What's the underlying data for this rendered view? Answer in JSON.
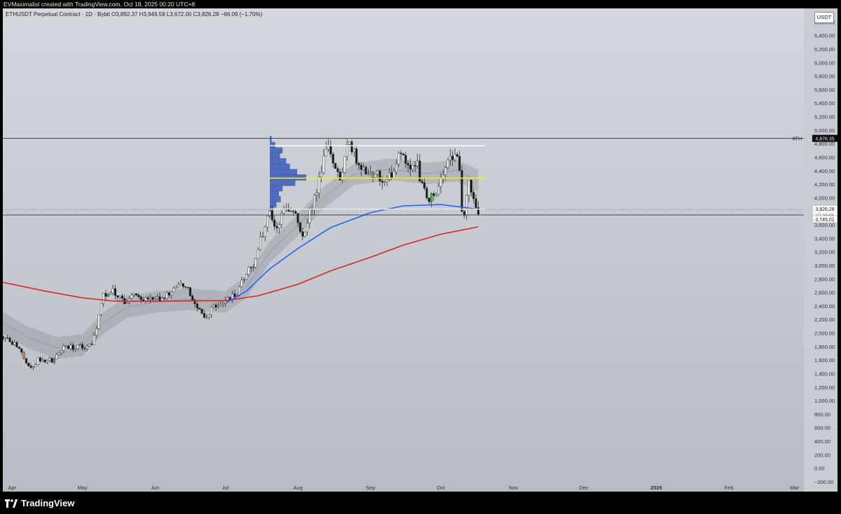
{
  "header": {
    "attribution": "EVMaximalist created with TradingView.com, Oct 18, 2025 00:20 UTC+8"
  },
  "legend": {
    "symbol": "ETHUSDT Perpetual Contract · 1D · Bybit",
    "ohlc": "O3,892.37  H3,949.59  L3,672.00  C3,826.28  −66.09 (−1.70%)"
  },
  "price_scale": {
    "unit": "USDT"
  },
  "footer": {
    "brand": "TradingView"
  },
  "colors": {
    "ma_fast": "#2962ff",
    "ma_slow": "#e02424",
    "poc_line": "#f0f020",
    "range_lines": "#ffffff",
    "volume_profile": "#3b5cb8",
    "ribbon": "#8a8d93",
    "candle_up": "#f7f7f7",
    "candle_down": "#1b1b1b",
    "candle_green": "#2ecc40",
    "candle_orange": "#c88040",
    "price_label_bg": "#ffffff",
    "ath_label_bg": "#000000"
  },
  "chart_data": {
    "type": "candlestick",
    "ylim": [
      -200,
      6800
    ],
    "y_ticks": [
      -200,
      0,
      200,
      400,
      600,
      800,
      1000,
      1200,
      1400,
      1600,
      1800,
      2000,
      2200,
      2400,
      2600,
      2800,
      3000,
      3200,
      3400,
      3600,
      3800,
      4000,
      4200,
      4400,
      4600,
      4800,
      5000,
      5200,
      5400,
      5600,
      5800,
      6000,
      6200,
      6400,
      6600
    ],
    "y_tick_labels": [
      "−200.00",
      "0.00",
      "200.00",
      "400.00",
      "600.00",
      "800.00",
      "1,000.00",
      "1,200.00",
      "1,400.00",
      "1,600.00",
      "1,800.00",
      "2,000.00",
      "2,200.00",
      "2,400.00",
      "2,600.00",
      "2,800.00",
      "3,000.00",
      "3,200.00",
      "3,400.00",
      "3,600.00",
      "3,800.00",
      "4,000.00",
      "4,200.00",
      "4,400.00",
      "4,600.00",
      "4,800.00",
      "5,000.00",
      "5,200.00",
      "5,400.00",
      "5,600.00",
      "5,800.00",
      "6,000.00",
      "6,200.00",
      "6,400.00",
      "6,600.00"
    ],
    "x_range": [
      "2025-03-28",
      "2026-03-05"
    ],
    "x_ticks": [
      {
        "date": "2025-04-01",
        "label": "Apr"
      },
      {
        "date": "2025-05-01",
        "label": "May"
      },
      {
        "date": "2025-06-01",
        "label": "Jun"
      },
      {
        "date": "2025-07-01",
        "label": "Jul"
      },
      {
        "date": "2025-08-01",
        "label": "Aug"
      },
      {
        "date": "2025-09-01",
        "label": "Sep"
      },
      {
        "date": "2025-10-01",
        "label": "Oct"
      },
      {
        "date": "2025-11-01",
        "label": "Nov"
      },
      {
        "date": "2025-12-01",
        "label": "Dec"
      },
      {
        "date": "2026-01-01",
        "label": "2026"
      },
      {
        "date": "2026-02-01",
        "label": "Feb"
      },
      {
        "date": "2026-03-01",
        "label": "Mar"
      }
    ],
    "close_path": [
      [
        "2025-03-28",
        1950
      ],
      [
        "2025-04-03",
        1800
      ],
      [
        "2025-04-07",
        1580
      ],
      [
        "2025-04-09",
        1490
      ],
      [
        "2025-04-12",
        1600
      ],
      [
        "2025-04-18",
        1590
      ],
      [
        "2025-04-23",
        1790
      ],
      [
        "2025-04-30",
        1790
      ],
      [
        "2025-05-05",
        1810
      ],
      [
        "2025-05-08",
        2240
      ],
      [
        "2025-05-10",
        2560
      ],
      [
        "2025-05-13",
        2650
      ],
      [
        "2025-05-18",
        2470
      ],
      [
        "2025-05-24",
        2540
      ],
      [
        "2025-05-30",
        2520
      ],
      [
        "2025-06-05",
        2500
      ],
      [
        "2025-06-11",
        2760
      ],
      [
        "2025-06-16",
        2600
      ],
      [
        "2025-06-22",
        2240
      ],
      [
        "2025-06-27",
        2420
      ],
      [
        "2025-07-01",
        2450
      ],
      [
        "2025-07-06",
        2580
      ],
      [
        "2025-07-10",
        2900
      ],
      [
        "2025-07-13",
        3020
      ],
      [
        "2025-07-16",
        3400
      ],
      [
        "2025-07-20",
        3750
      ],
      [
        "2025-07-23",
        3600
      ],
      [
        "2025-07-27",
        3850
      ],
      [
        "2025-07-31",
        3700
      ],
      [
        "2025-08-03",
        3450
      ],
      [
        "2025-08-06",
        3800
      ],
      [
        "2025-08-09",
        4100
      ],
      [
        "2025-08-12",
        4600
      ],
      [
        "2025-08-14",
        4700
      ],
      [
        "2025-08-16",
        4420
      ],
      [
        "2025-08-19",
        4300
      ],
      [
        "2025-08-22",
        4800
      ],
      [
        "2025-08-24",
        4780
      ],
      [
        "2025-08-27",
        4520
      ],
      [
        "2025-08-31",
        4380
      ],
      [
        "2025-09-03",
        4320
      ],
      [
        "2025-09-07",
        4300
      ],
      [
        "2025-09-11",
        4380
      ],
      [
        "2025-09-14",
        4650
      ],
      [
        "2025-09-17",
        4500
      ],
      [
        "2025-09-21",
        4480
      ],
      [
        "2025-09-25",
        3920
      ],
      [
        "2025-09-28",
        4050
      ],
      [
        "2025-10-01",
        4320
      ],
      [
        "2025-10-04",
        4500
      ],
      [
        "2025-10-07",
        4680
      ],
      [
        "2025-10-09",
        4360
      ],
      [
        "2025-10-10",
        3750
      ],
      [
        "2025-10-11",
        3780
      ],
      [
        "2025-10-13",
        4200
      ],
      [
        "2025-10-15",
        4050
      ],
      [
        "2025-10-17",
        3826
      ]
    ],
    "ma_fast_path": [
      [
        "2025-07-01",
        2440
      ],
      [
        "2025-07-10",
        2620
      ],
      [
        "2025-07-20",
        2950
      ],
      [
        "2025-08-01",
        3250
      ],
      [
        "2025-08-15",
        3560
      ],
      [
        "2025-09-01",
        3780
      ],
      [
        "2025-09-15",
        3880
      ],
      [
        "2025-10-01",
        3900
      ],
      [
        "2025-10-17",
        3830
      ]
    ],
    "ma_slow_path": [
      [
        "2025-03-28",
        2750
      ],
      [
        "2025-04-15",
        2620
      ],
      [
        "2025-05-01",
        2520
      ],
      [
        "2025-05-15",
        2470
      ],
      [
        "2025-06-01",
        2470
      ],
      [
        "2025-06-15",
        2475
      ],
      [
        "2025-07-01",
        2480
      ],
      [
        "2025-07-15",
        2550
      ],
      [
        "2025-08-01",
        2720
      ],
      [
        "2025-08-15",
        2920
      ],
      [
        "2025-09-01",
        3120
      ],
      [
        "2025-09-15",
        3300
      ],
      [
        "2025-10-01",
        3460
      ],
      [
        "2025-10-17",
        3570
      ]
    ],
    "ribbon_path": [
      [
        "2025-03-28",
        2150
      ],
      [
        "2025-04-08",
        1930
      ],
      [
        "2025-04-20",
        1780
      ],
      [
        "2025-05-01",
        1820
      ],
      [
        "2025-05-10",
        2150
      ],
      [
        "2025-05-20",
        2380
      ],
      [
        "2025-06-01",
        2460
      ],
      [
        "2025-06-15",
        2500
      ],
      [
        "2025-07-01",
        2460
      ],
      [
        "2025-07-10",
        2680
      ],
      [
        "2025-07-20",
        3200
      ],
      [
        "2025-08-01",
        3600
      ],
      [
        "2025-08-12",
        4000
      ],
      [
        "2025-08-25",
        4350
      ],
      [
        "2025-09-10",
        4420
      ],
      [
        "2025-09-25",
        4360
      ],
      [
        "2025-10-08",
        4400
      ],
      [
        "2025-10-17",
        4250
      ]
    ],
    "range_box": {
      "top": 4770,
      "bottom": 3830,
      "start": "2025-07-20",
      "end": "2025-10-20"
    },
    "poc_price": 4290,
    "ath": {
      "label": "ATH",
      "price": "4,878.35",
      "value": 4878.35
    },
    "current_price": {
      "price": "3,826.28",
      "countdown": "07:39:58",
      "value": 3826.28
    },
    "mark_price": {
      "price": "3,745.01",
      "value": 3745.01
    },
    "volume_profile": {
      "start": "2025-07-20",
      "bins": [
        [
          4870,
          0.05
        ],
        [
          4780,
          0.15
        ],
        [
          4700,
          0.35
        ],
        [
          4620,
          0.28
        ],
        [
          4540,
          0.45
        ],
        [
          4460,
          0.55
        ],
        [
          4380,
          0.75
        ],
        [
          4300,
          1.0
        ],
        [
          4220,
          0.7
        ],
        [
          4140,
          0.35
        ],
        [
          4060,
          0.25
        ],
        [
          3980,
          0.3
        ],
        [
          3900,
          0.18
        ],
        [
          3840,
          0.1
        ]
      ]
    }
  }
}
